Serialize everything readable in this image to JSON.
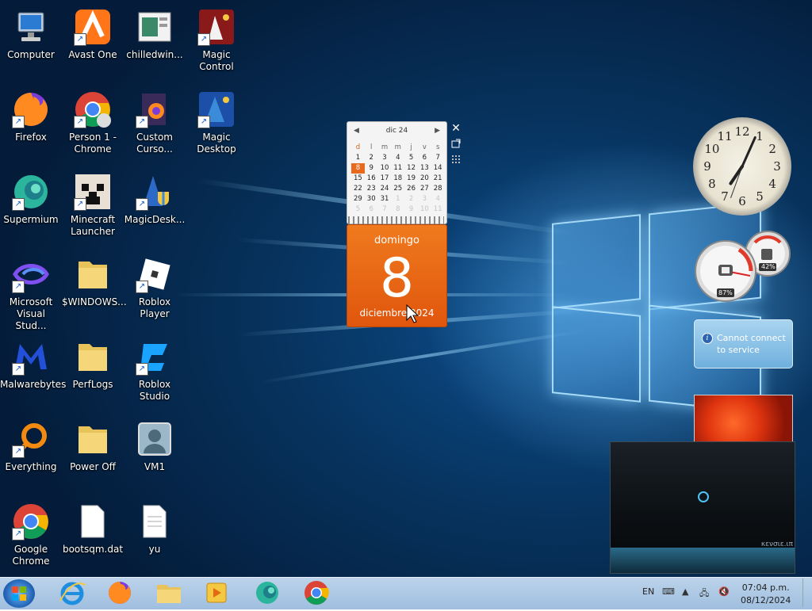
{
  "desktop": {
    "icons": [
      {
        "name": "computer",
        "label": "Computer"
      },
      {
        "name": "avast-one",
        "label": "Avast One"
      },
      {
        "name": "chilledwin",
        "label": "chilledwin..."
      },
      {
        "name": "magic-control",
        "label": "Magic Control"
      },
      {
        "name": "firefox",
        "label": "Firefox"
      },
      {
        "name": "person1-chrome",
        "label": "Person 1 - Chrome"
      },
      {
        "name": "custom-curso",
        "label": "Custom Curso..."
      },
      {
        "name": "magic-desktop",
        "label": "Magic Desktop"
      },
      {
        "name": "supermium",
        "label": "Supermium"
      },
      {
        "name": "minecraft-launcher",
        "label": "Minecraft Launcher"
      },
      {
        "name": "magicdesk",
        "label": "MagicDesk..."
      },
      {
        "name": "ms-visual-studio",
        "label": "Microsoft Visual Stud..."
      },
      {
        "name": "windows-folder",
        "label": "$WINDOWS..."
      },
      {
        "name": "roblox-player",
        "label": "Roblox Player"
      },
      {
        "name": "malwarebytes",
        "label": "Malwarebytes"
      },
      {
        "name": "perflogs",
        "label": "PerfLogs"
      },
      {
        "name": "roblox-studio",
        "label": "Roblox Studio"
      },
      {
        "name": "everything",
        "label": "Everything"
      },
      {
        "name": "power-off",
        "label": "Power Off"
      },
      {
        "name": "vm1",
        "label": "VM1"
      },
      {
        "name": "google-chrome",
        "label": "Google Chrome"
      },
      {
        "name": "bootsqm",
        "label": "bootsqm.dat"
      },
      {
        "name": "yu",
        "label": "yu"
      }
    ]
  },
  "calendar": {
    "month_label": "dic 24",
    "weekdays": [
      "d",
      "l",
      "m",
      "m",
      "j",
      "v",
      "s"
    ],
    "weeks": [
      [
        "1",
        "2",
        "3",
        "4",
        "5",
        "6",
        "7"
      ],
      [
        "8",
        "9",
        "10",
        "11",
        "12",
        "13",
        "14"
      ],
      [
        "15",
        "16",
        "17",
        "18",
        "19",
        "20",
        "21"
      ],
      [
        "22",
        "23",
        "24",
        "25",
        "26",
        "27",
        "28"
      ],
      [
        "29",
        "30",
        "31",
        "1",
        "2",
        "3",
        "4"
      ],
      [
        "5",
        "6",
        "7",
        "8",
        "9",
        "10",
        "11"
      ]
    ],
    "day_name": "domingo",
    "day_number": "8",
    "month_year": "diciembre 2024",
    "close_glyph": "✕"
  },
  "clock": {
    "numbers": [
      "12",
      "1",
      "2",
      "3",
      "4",
      "5",
      "6",
      "7",
      "8",
      "9",
      "10",
      "11"
    ]
  },
  "meters": {
    "cpu_percent": "87%",
    "ram_percent": "42%"
  },
  "weather": {
    "message": "Cannot connect to service",
    "icon": "i"
  },
  "media": {
    "status_text": "κενσιε.ιπ"
  },
  "tray": {
    "language": "EN",
    "time": "07:04 p.m.",
    "date": "08/12/2024"
  }
}
